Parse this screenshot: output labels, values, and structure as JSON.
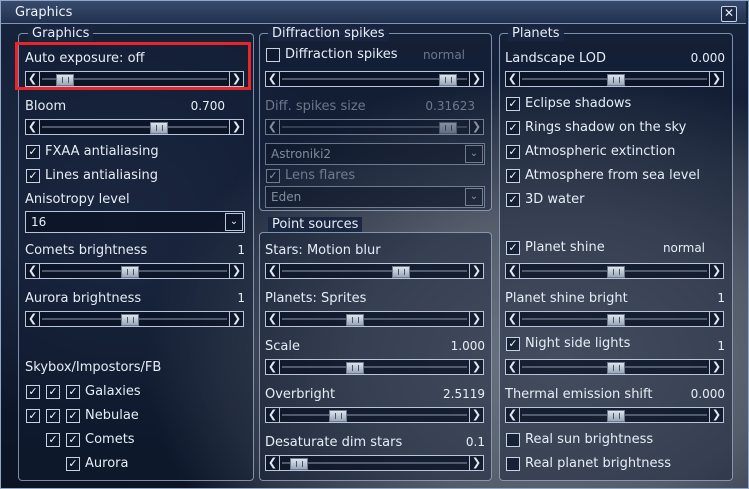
{
  "window": {
    "title": "Graphics",
    "close_glyph": "✕"
  },
  "graphics": {
    "legend": "Graphics",
    "auto_exposure": {
      "label": "Auto exposure: off",
      "pos": 0.08
    },
    "bloom": {
      "label": "Bloom",
      "value": "0.700",
      "pos": 0.64
    },
    "fxaa": {
      "label": "FXAA antialiasing",
      "checked": true
    },
    "lines_aa": {
      "label": "Lines antialiasing",
      "checked": true
    },
    "anisotropy": {
      "label": "Anisotropy level",
      "selected": "16"
    },
    "comets_brightness": {
      "label": "Comets brightness",
      "value": "1",
      "pos": 0.47
    },
    "aurora_brightness": {
      "label": "Aurora brightness",
      "value": "1",
      "pos": 0.47
    },
    "skybox": {
      "label": "Skybox/Impostors/FB",
      "rows": [
        {
          "label": "Galaxies"
        },
        {
          "label": "Nebulae"
        },
        {
          "label": "Comets"
        },
        {
          "label": "Aurora"
        }
      ]
    }
  },
  "diffraction": {
    "legend": "Diffraction spikes",
    "enable": {
      "label": "Diffraction spikes",
      "checked": false,
      "mode": "normal"
    },
    "size": {
      "label": "Diff. spikes size",
      "value": "0.31623",
      "pos": 0.93
    },
    "texture": "Astroniki2",
    "lens_flares": {
      "label": "Lens flares",
      "checked": true
    },
    "flare_style": "Eden"
  },
  "point_sources": {
    "legend": "Point sources",
    "motion_blur": {
      "label": "Stars: Motion blur",
      "pos": 0.65
    },
    "planets_sprites": {
      "label": "Planets: Sprites",
      "pos": 0.38
    },
    "scale": {
      "label": "Scale",
      "value": "1.000",
      "pos": 0.38
    },
    "overbright": {
      "label": "Overbright",
      "value": "2.5119",
      "pos": 0.28
    },
    "desaturate": {
      "label": "Desaturate dim stars",
      "value": "0.1",
      "pos": 0.05
    }
  },
  "planets": {
    "legend": "Planets",
    "landscape_lod": {
      "label": "Landscape LOD",
      "value": "0.000",
      "pos": 0.5
    },
    "eclipse": {
      "label": "Eclipse shadows",
      "checked": true
    },
    "rings_shadow": {
      "label": "Rings shadow on the sky",
      "checked": true
    },
    "atm_extinction": {
      "label": "Atmospheric extinction",
      "checked": true
    },
    "atm_sea": {
      "label": "Atmosphere from sea level",
      "checked": true
    },
    "water3d": {
      "label": "3D water",
      "checked": true
    },
    "planet_shine": {
      "label": "Planet shine",
      "checked": true,
      "mode": "normal",
      "pos": 0.5
    },
    "shine_bright": {
      "label": "Planet shine bright",
      "value": "1",
      "pos": 0.5
    },
    "night_lights": {
      "label": "Night side lights",
      "checked": true,
      "value": "1",
      "pos": 0.5
    },
    "thermal": {
      "label": "Thermal emission shift",
      "value": "0.000",
      "pos": 0.5
    },
    "real_sun": {
      "label": "Real sun brightness",
      "checked": false
    },
    "real_planet": {
      "label": "Real planet brightness",
      "checked": false
    }
  },
  "glyphs": {
    "check": "✓",
    "left": "❮",
    "right": "❯",
    "down": "⌄"
  },
  "colors": {
    "highlight": "#e8262a",
    "border": "#b7c6dc"
  }
}
